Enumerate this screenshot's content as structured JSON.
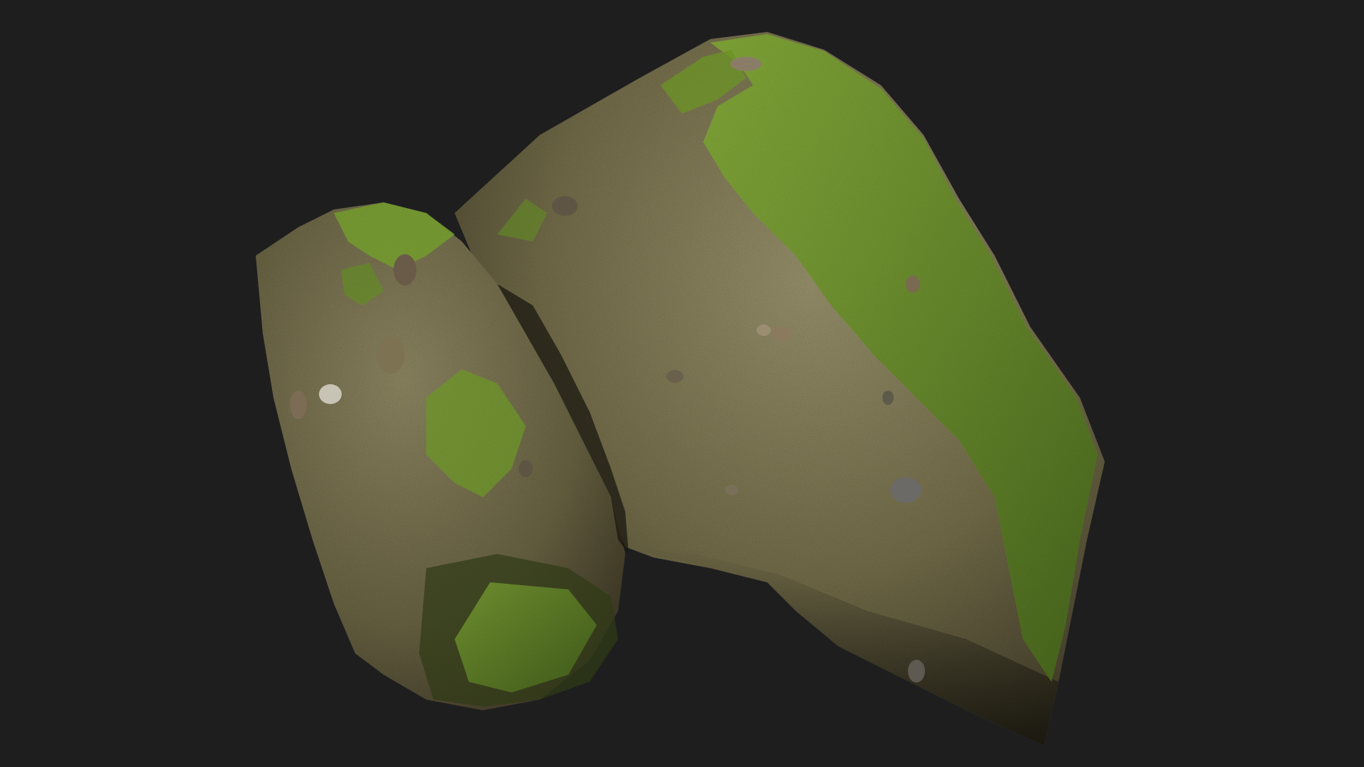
{
  "scene": {
    "subject": "moss-covered-conglomerate-boulder",
    "colors": {
      "background": "#1e1e1f",
      "rock_base": "#6f6a4a",
      "rock_light": "#9a9470",
      "rock_shadow": "#3f3a28",
      "moss_bright": "#7fa534",
      "moss_dark": "#4d6e1f",
      "rust_tint": "#6a3a24"
    },
    "features": [
      "large-rear-rock",
      "small-front-rock",
      "moss-cover",
      "embedded-pebbles"
    ]
  }
}
